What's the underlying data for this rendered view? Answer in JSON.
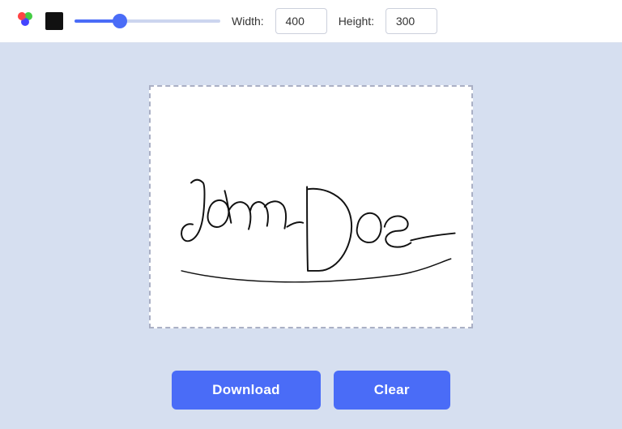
{
  "toolbar": {
    "width_label": "Width:",
    "width_value": "400",
    "height_label": "Height:",
    "height_value": "300",
    "slider_value": 30
  },
  "canvas": {
    "aria_label": "Signature canvas"
  },
  "buttons": {
    "download_label": "Download",
    "clear_label": "Clear"
  }
}
